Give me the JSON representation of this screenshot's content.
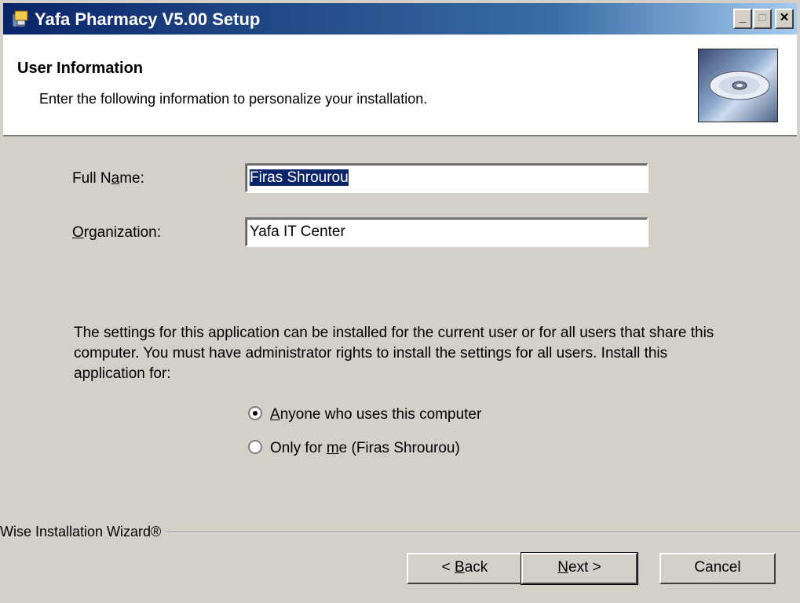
{
  "window": {
    "title": "Yafa Pharmacy V5.00 Setup",
    "controls": {
      "minimize": "_",
      "maximize": "□",
      "close": "✕"
    }
  },
  "header": {
    "title": "User Information",
    "subtitle": "Enter the following information to personalize your installation.",
    "image_icon": "cd-disc-icon"
  },
  "form": {
    "full_name": {
      "label_pre": "Full N",
      "label_accel": "a",
      "label_post": "me:",
      "value": "Firas Shrourou"
    },
    "organization": {
      "label_pre": "",
      "label_accel": "O",
      "label_post": "rganization:",
      "value": "Yafa IT Center"
    }
  },
  "install_scope": {
    "description": "The settings for this application can be installed for the current user or for all users that share this computer. You must have administrator rights to install the settings for all users. Install this application for:",
    "options": [
      {
        "accel": "A",
        "rest": "nyone who uses this computer",
        "selected": true
      },
      {
        "pre": "Only for ",
        "accel": "m",
        "rest": "e (Firas Shrourou)",
        "selected": false
      }
    ]
  },
  "footer": {
    "branding": "Wise Installation Wizard®",
    "back": {
      "pre": "< ",
      "accel": "B",
      "rest": "ack"
    },
    "next": {
      "pre": "",
      "accel": "N",
      "rest": "ext >"
    },
    "cancel": "Cancel"
  }
}
